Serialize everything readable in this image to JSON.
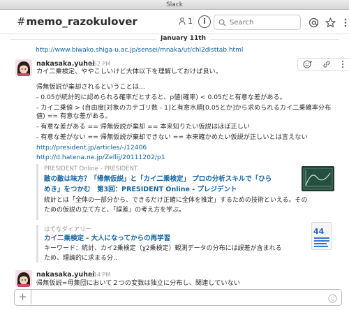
{
  "window": {
    "title": "Slack"
  },
  "header": {
    "channel_name": "memo_razokulover",
    "member_count": "1",
    "info_label": "i",
    "search_placeholder": "Search"
  },
  "feed": {
    "day_label": "January 11th",
    "prev_link": "http://www.biwako.shiga-u.ac.jp/sensei/mnaka/ut/chi2disttab.html",
    "messages": [
      {
        "author": "nakasaka.yuhei",
        "time": "8:52 PM",
        "lines": [
          "カイ二乗検定、ややこしいけど大体以下を理解しておけば良い。",
          "",
          "帰無仮説が棄却されるということは...",
          "- 0.05が統計的に認められる確率だとすると、p値(確率) < 0.05だと有意な差がある。",
          "- カイ二乗値 > (自由度[対象のカテゴリ数 - 1]と有意水順[0.05とか]から求められるカイ二乗確率分布",
          "値) == 有意な差がある。",
          "- 有意な差がある == 帰無仮説が棄却 == 本来知りたい仮説はほぼ正しい",
          "- 有意な差がない == 帰無仮説が棄却できない == 本来確かめたい仮説が正しいとは言えない"
        ],
        "links": [
          "http://president.jp/articles/-/12406",
          "http://d.hatena.ne.jp/Zellij/20111202/p1"
        ],
        "attachments": [
          {
            "source": "PRESIDENT Online - PRESIDENT",
            "title_lines": [
              "敵の敵は味方？「帰無仮説」と「カイ二乗検定」 プロの分析スキルで「ひら",
              "めき」をつかむ　第3回：PRESIDENT Online - プレジデント"
            ],
            "desc_lines": [
              "統計とは「全体の一部分から、できるだけ正確に全体を推定」するための技術といえる。その",
              "ための仮説の立て方と、「誤差」の考え方を学ぶ。"
            ]
          },
          {
            "source": "はてなダイアリー",
            "title_lines": [
              "カイ二乗検定 - 大人になってからの再学習"
            ],
            "desc_lines": [
              "キーワード：統計、カイ2乗検定（χ2乗検定）観測データの分布には誤差が含まれる",
              "ため、理論的に求まる分.."
            ],
            "thumb_text": "44"
          }
        ]
      },
      {
        "author": "nakasaka.yuhei",
        "time": "9:14 PM",
        "lines": [
          "帰無仮説=母集団において２つの変数は独立に分布し、関連していない"
        ]
      }
    ]
  },
  "composer": {
    "plus_label": "+",
    "placeholder": ""
  }
}
